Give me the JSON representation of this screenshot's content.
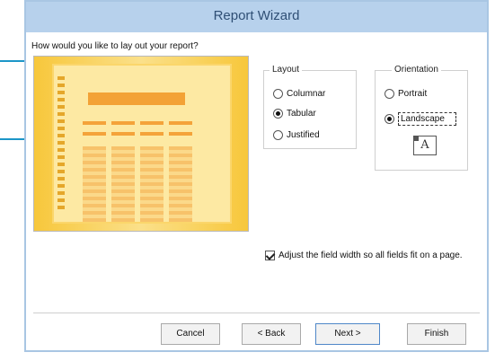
{
  "window": {
    "title": "Report Wizard"
  },
  "question": "How would you like to lay out your report?",
  "layout": {
    "group_label": "Layout",
    "options": [
      {
        "label": "Columnar",
        "checked": false
      },
      {
        "label": "Tabular",
        "checked": true
      },
      {
        "label": "Justified",
        "checked": false
      }
    ]
  },
  "orientation": {
    "group_label": "Orientation",
    "options": [
      {
        "label": "Portrait",
        "checked": false
      },
      {
        "label": "Landscape",
        "checked": true
      }
    ],
    "icon_letter": "A"
  },
  "adjust_width": {
    "label": "Adjust the field width so all fields fit on a page.",
    "checked": true
  },
  "buttons": {
    "cancel": "Cancel",
    "back": "< Back",
    "next": "Next >",
    "finish": "Finish"
  },
  "colors": {
    "callout": "#1c96c8",
    "titlebar": "#b7d1ec",
    "preview_accent": "#f3a236"
  }
}
